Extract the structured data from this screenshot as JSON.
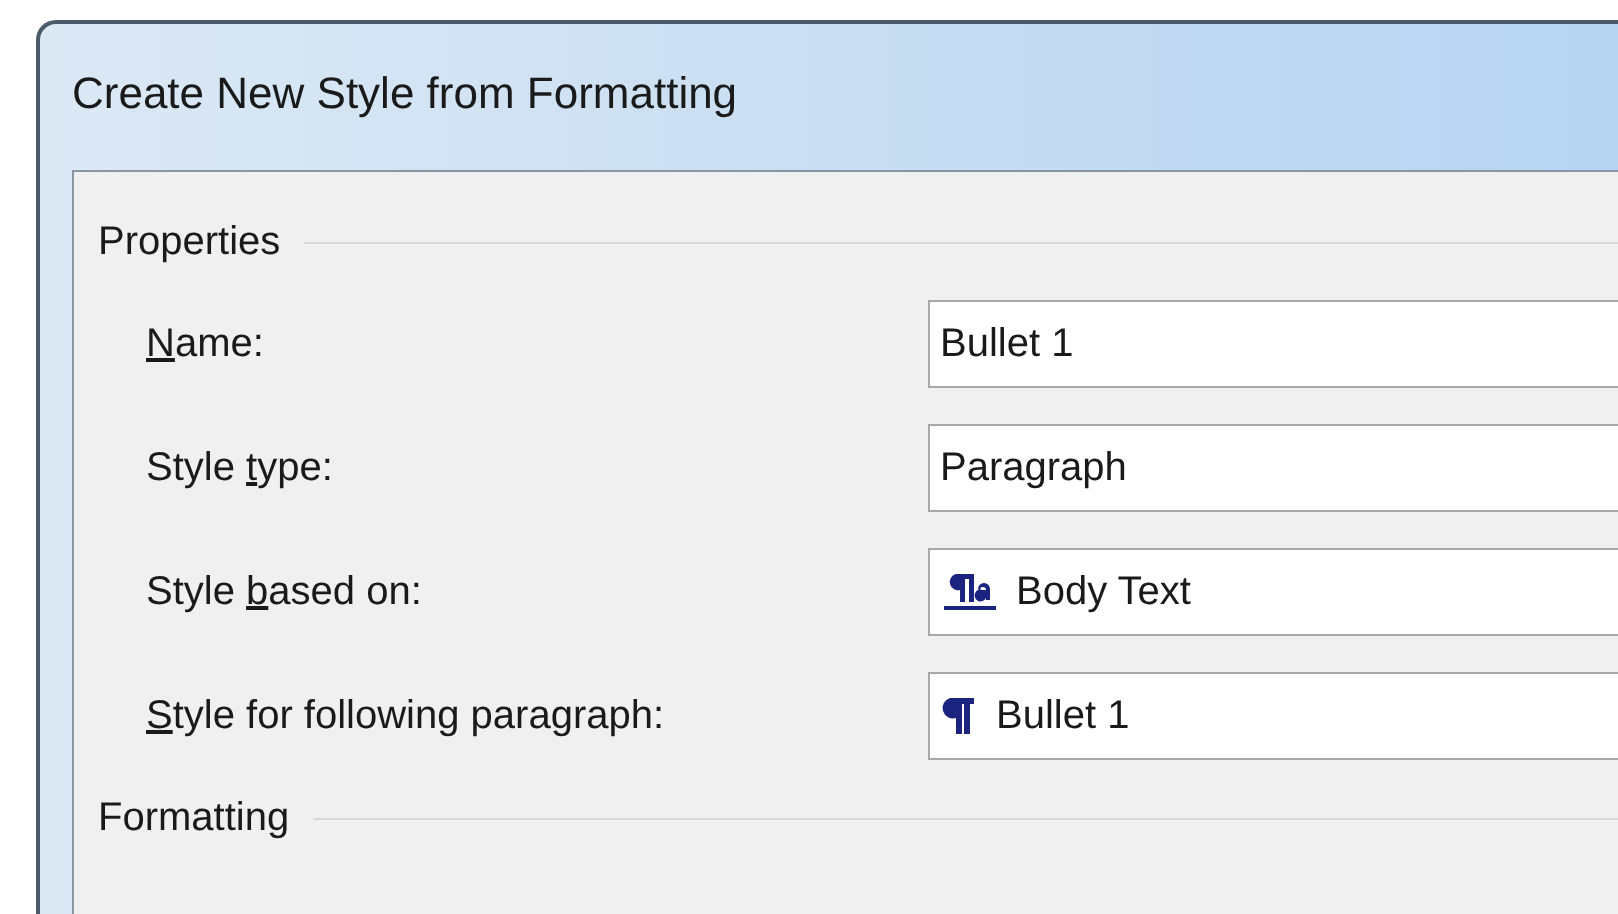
{
  "window": {
    "title": "Create New Style from Formatting"
  },
  "properties": {
    "heading": "Properties",
    "rows": [
      {
        "label_before": "",
        "access_key": "N",
        "label_after": "ame:",
        "field": {
          "value": "Bullet 1"
        }
      },
      {
        "label_before": "Style ",
        "access_key": "t",
        "label_after": "ype:",
        "field": {
          "value": "Paragraph"
        }
      },
      {
        "label_before": "Style ",
        "access_key": "b",
        "label_after": "ased on:",
        "field": {
          "kind": "linked-style",
          "value": "Body Text"
        }
      },
      {
        "label_before": "",
        "access_key": "S",
        "label_after": "tyle for following paragraph:",
        "field": {
          "kind": "paragraph-style",
          "value": "Bullet 1"
        }
      }
    ]
  },
  "formatting": {
    "heading": "Formatting"
  }
}
